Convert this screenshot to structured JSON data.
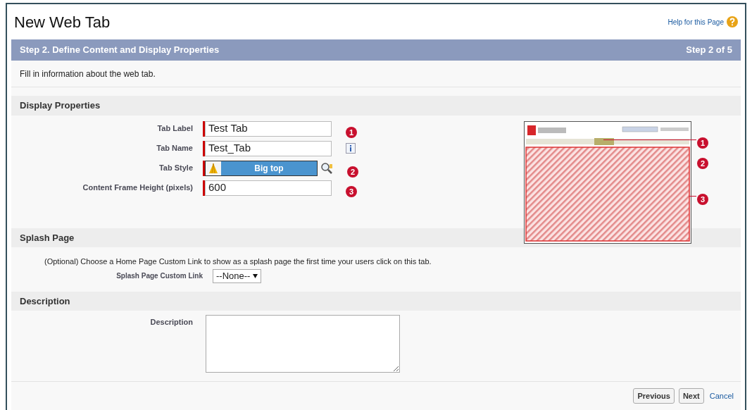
{
  "title": "New Web Tab",
  "help_link": "Help for this Page",
  "step_bar": {
    "title": "Step 2. Define Content and Display Properties",
    "step": "Step 2 of 5"
  },
  "intro": "Fill in information about the web tab.",
  "display_properties": {
    "heading": "Display Properties",
    "fields": [
      {
        "kind": "text",
        "label": "Tab Label",
        "value": "Test Tab",
        "badge": "1",
        "info": false
      },
      {
        "kind": "text",
        "label": "Tab Name",
        "value": "Test_Tab",
        "info": true
      },
      {
        "kind": "style",
        "label": "Tab Style",
        "value": "Big top",
        "badge": "2",
        "info": false
      },
      {
        "kind": "text",
        "label": "Content Frame Height (pixels)",
        "value": "600",
        "badge": "3",
        "info": false
      }
    ],
    "preview": {
      "callouts": [
        "1",
        "2",
        "3"
      ]
    }
  },
  "splash_page": {
    "heading": "Splash Page",
    "note": "(Optional) Choose a Home Page Custom Link to show as a splash page the first time your users click on this tab.",
    "label": "Splash Page Custom Link",
    "value": "--None--"
  },
  "description": {
    "heading": "Description",
    "label": "Description"
  },
  "buttons": [
    {
      "kind": "button",
      "label": "Previous"
    },
    {
      "kind": "button",
      "label": "Next"
    },
    {
      "kind": "link",
      "label": "Cancel"
    }
  ]
}
